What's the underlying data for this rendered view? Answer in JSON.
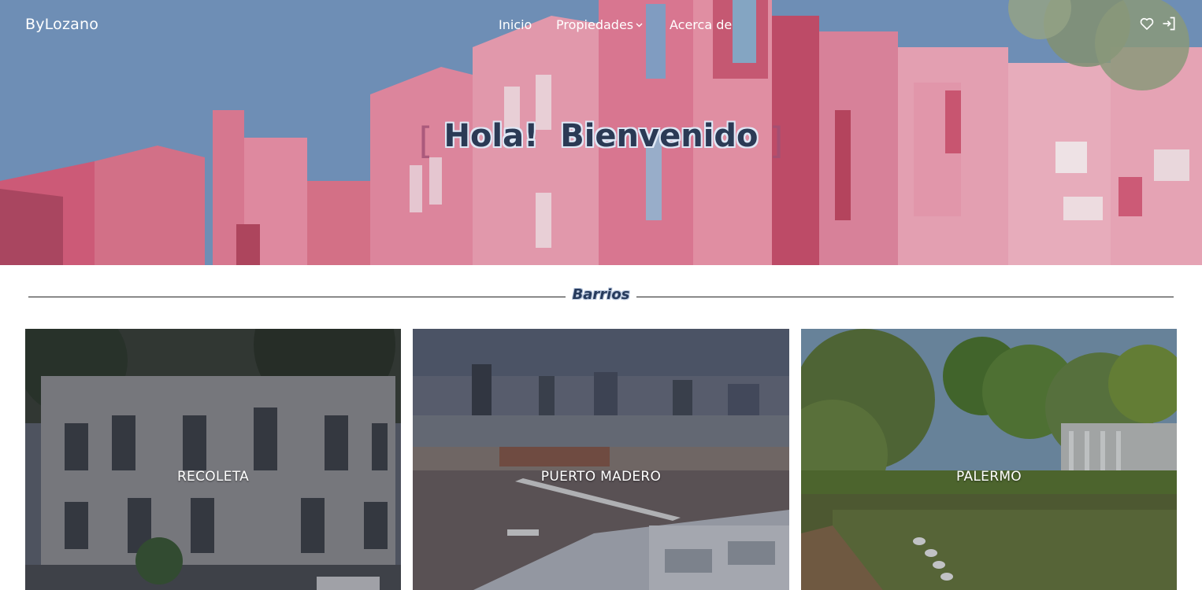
{
  "navbar": {
    "brand": "ByLozano",
    "links": [
      {
        "label": "Inicio"
      },
      {
        "label": "Propiedades",
        "has_dropdown": true
      },
      {
        "label": "Acerca de"
      }
    ],
    "icons": [
      "heart-icon",
      "login-icon"
    ]
  },
  "hero": {
    "title": "Hola!  Bienvenido",
    "bracket_left": "[",
    "bracket_right": "]"
  },
  "section": {
    "title": "Barrios"
  },
  "neighborhoods": [
    {
      "label": "RECOLETA"
    },
    {
      "label": "PUERTO MADERO"
    },
    {
      "label": "PALERMO"
    }
  ],
  "colors": {
    "hero_pink": "#e58aa6",
    "sky_blue": "#7b9bc3",
    "title_text": "#2b3a55",
    "rule": "#222222"
  }
}
